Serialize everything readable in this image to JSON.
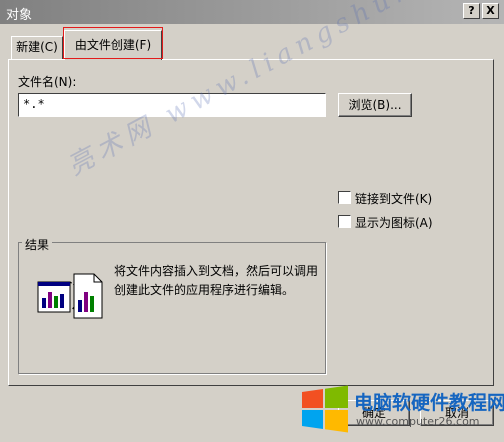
{
  "window": {
    "title": "对象",
    "help_label": "?",
    "close_label": "X"
  },
  "tabs": [
    {
      "label": "新建(C)",
      "active": false
    },
    {
      "label": "由文件创建(F)",
      "active": true
    }
  ],
  "file": {
    "label": "文件名(N):",
    "value": "*.*",
    "browse_label": "浏览(B)..."
  },
  "options": {
    "link_label": "链接到文件(K)",
    "icon_label": "显示为图标(A)",
    "link_checked": false,
    "icon_checked": false
  },
  "result": {
    "title": "结果",
    "text": "将文件内容插入到文档，然后可以调用创建此文件的应用程序进行编辑。"
  },
  "buttons": {
    "ok_label": "确定",
    "cancel_label": "取消"
  },
  "watermark": {
    "text": "亮术网 www.liangshunet.com"
  },
  "logo": {
    "text": "电脑软硬件教程网",
    "url": "www.computer26.com",
    "colors": [
      "#f25022",
      "#7fba00",
      "#00a4ef",
      "#ffb900"
    ]
  },
  "colors": {
    "dialog_bg": "#d4d0c8",
    "tab_highlight": "#e21b1b"
  }
}
